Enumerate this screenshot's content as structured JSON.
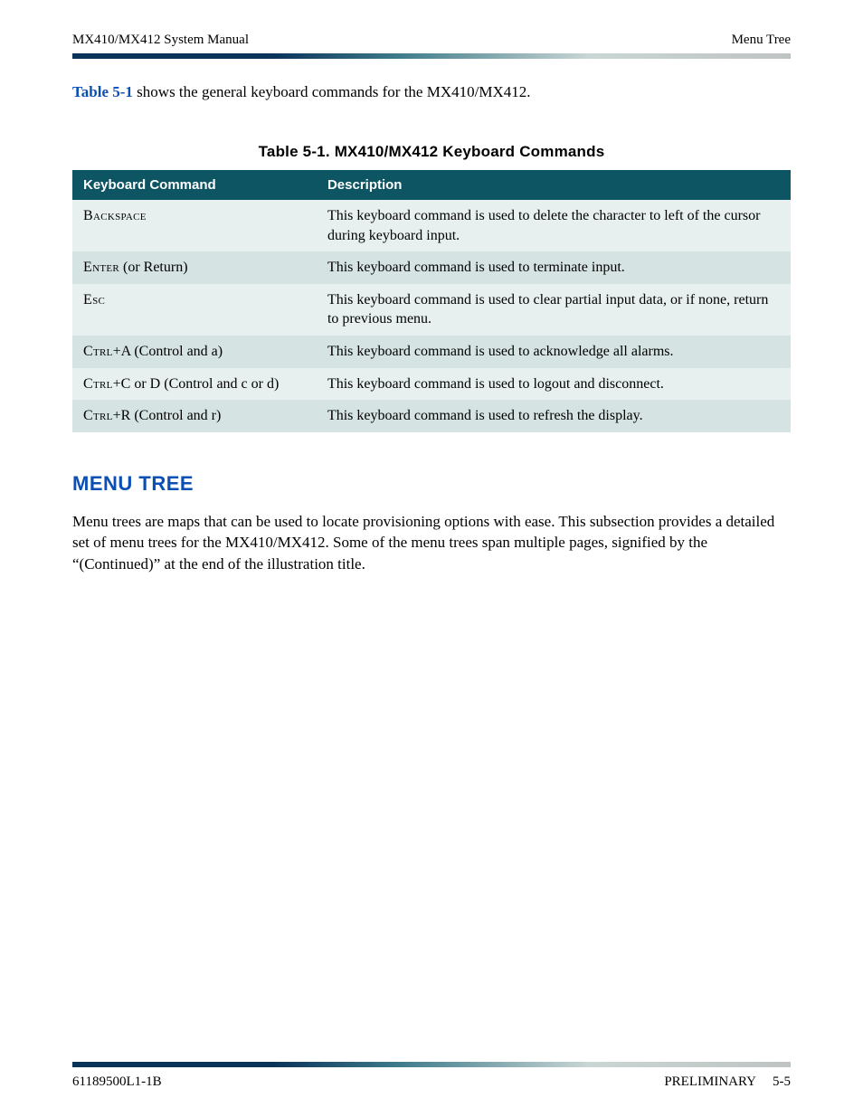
{
  "header": {
    "left": "MX410/MX412 System Manual",
    "right": "Menu Tree"
  },
  "intro": {
    "ref": "Table 5-1",
    "rest": " shows the general keyboard commands for the MX410/MX412."
  },
  "table": {
    "caption": "Table 5-1.  MX410/MX412 Keyboard Commands",
    "headers": [
      "Keyboard Command",
      "Description"
    ],
    "rows": [
      {
        "cmd_sc": "Backspace",
        "cmd_tail": "",
        "desc": "This keyboard command is used to delete the character to left of the cursor during keyboard input."
      },
      {
        "cmd_sc": "Enter",
        "cmd_tail": " (or Return)",
        "desc": "This keyboard command is used to terminate input."
      },
      {
        "cmd_sc": "Esc",
        "cmd_tail": "",
        "desc": "This keyboard command is used to clear partial input data, or if none, return to previous menu."
      },
      {
        "cmd_sc": "Ctrl",
        "cmd_tail": "+A (Control and a)",
        "desc": "This keyboard command is used to acknowledge all alarms."
      },
      {
        "cmd_sc": "Ctrl",
        "cmd_tail": "+C or D (Control and c or d)",
        "desc": "This keyboard command is used to logout and disconnect."
      },
      {
        "cmd_sc": "Ctrl",
        "cmd_tail": "+R (Control and r)",
        "desc": "This keyboard command is used to refresh the display."
      }
    ]
  },
  "section": {
    "heading": "MENU TREE",
    "para": "Menu trees are maps that can be used to locate provisioning options with ease. This subsection provides a detailed set of menu trees for the MX410/MX412. Some of the menu trees span multiple pages, signified by the “(Continued)” at the end of the illustration title."
  },
  "footer": {
    "left": "61189500L1-1B",
    "center": "PRELIMINARY",
    "page": "5-5"
  }
}
